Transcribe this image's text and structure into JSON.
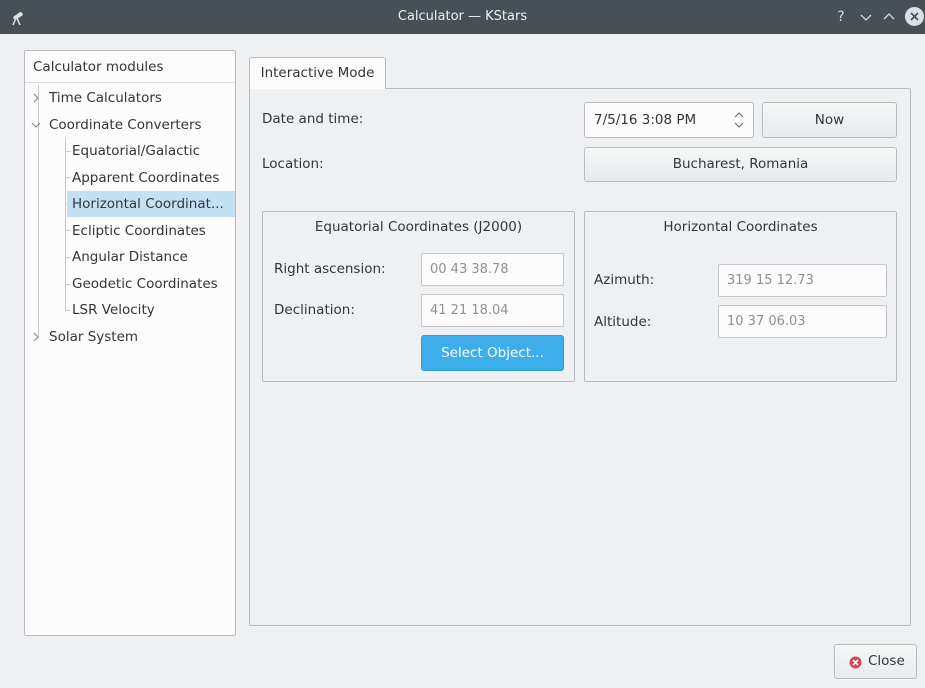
{
  "window": {
    "title": "Calculator — KStars",
    "controls": {
      "help": "?",
      "minimize": "⌄",
      "maximize": "⌃",
      "close": "✕"
    }
  },
  "sidebar": {
    "header": "Calculator modules",
    "items": [
      {
        "label": "Time Calculators",
        "expandable": true
      },
      {
        "label": "Coordinate Converters",
        "expandable": true,
        "expanded": true
      },
      {
        "label": "Equatorial/Galactic"
      },
      {
        "label": "Apparent Coordinates"
      },
      {
        "label": "Horizontal Coordinat...",
        "selected": true
      },
      {
        "label": "Ecliptic Coordinates"
      },
      {
        "label": "Angular Distance"
      },
      {
        "label": "Geodetic Coordinates"
      },
      {
        "label": "LSR Velocity"
      },
      {
        "label": "Solar System",
        "expandable": true
      }
    ]
  },
  "tabs": [
    {
      "label": "Interactive Mode",
      "active": true
    }
  ],
  "main": {
    "date_label": "Date and time:",
    "date_value": "7/5/16 3:08 PM",
    "now_button": "Now",
    "location_label": "Location:",
    "location_button": "Bucharest, Romania",
    "equatorial": {
      "title": "Equatorial Coordinates (J2000)",
      "ra_label": "Right ascension:",
      "ra_value": "00 43 38.78",
      "dec_label": "Declination:",
      "dec_value": "41 21 18.04",
      "select_button": "Select Object..."
    },
    "horizontal": {
      "title": "Horizontal Coordinates",
      "az_label": "Azimuth:",
      "az_value": "319 15 12.73",
      "alt_label": "Altitude:",
      "alt_value": "10 37 06.03"
    }
  },
  "footer": {
    "close_button": "Close"
  },
  "colors": {
    "accent": "#3daee9",
    "selection": "#c4e1f4",
    "titlebar": "#475057",
    "close_icon": "#da4453"
  }
}
